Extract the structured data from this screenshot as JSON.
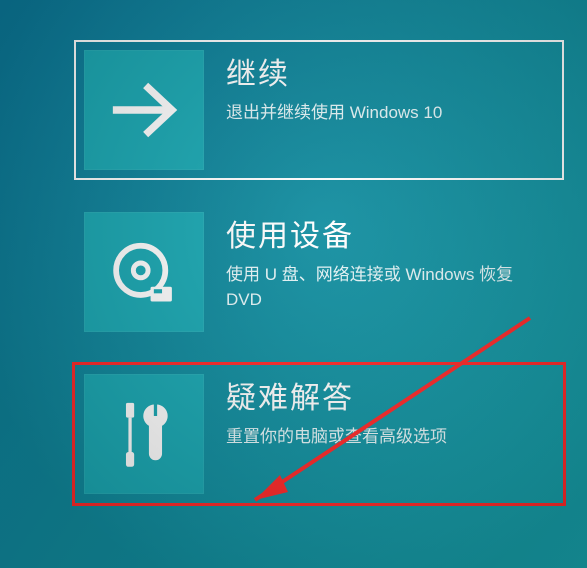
{
  "options": [
    {
      "id": "continue",
      "icon": "arrow-right-icon",
      "title": "继续",
      "desc": "退出并继续使用 Windows 10",
      "selected": true,
      "highlighted": false
    },
    {
      "id": "use-device",
      "icon": "disc-device-icon",
      "title": "使用设备",
      "desc": "使用 U 盘、网络连接或 Windows 恢复 DVD",
      "selected": false,
      "highlighted": false
    },
    {
      "id": "troubleshoot",
      "icon": "tools-icon",
      "title": "疑难解答",
      "desc": "重置你的电脑或查看高级选项",
      "selected": false,
      "highlighted": true
    }
  ],
  "colors": {
    "iconTile": "#1aa9b4",
    "highlight": "#ff2a2a",
    "text": "#ffffff"
  }
}
